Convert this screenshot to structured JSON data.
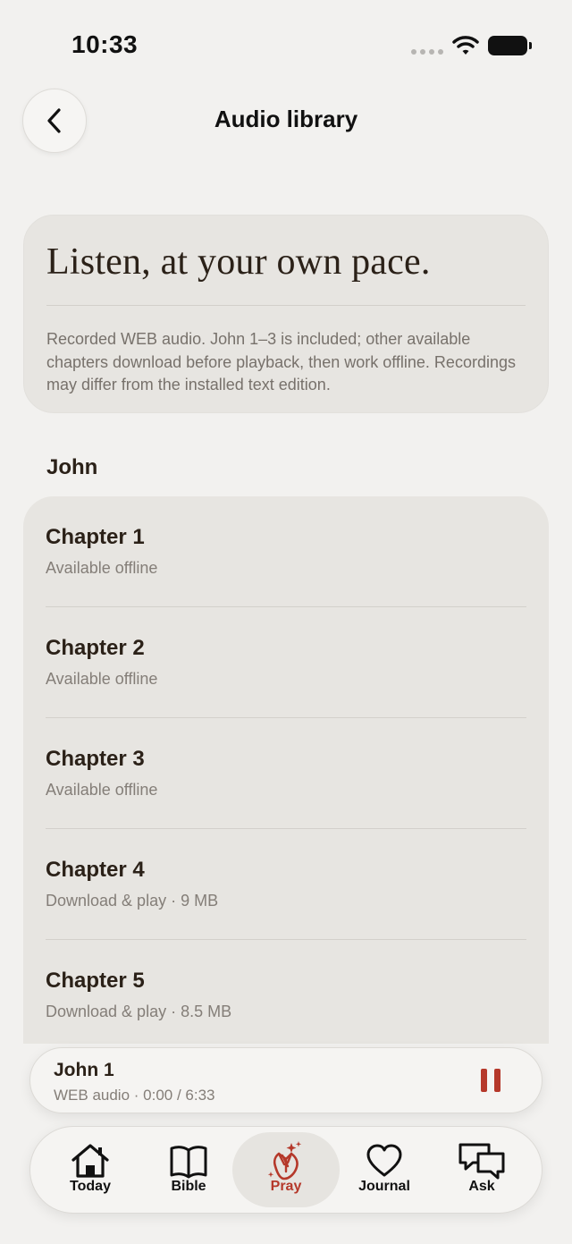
{
  "status_bar": {
    "time": "10:33"
  },
  "header": {
    "title": "Audio library"
  },
  "hero": {
    "heading": "Listen, at your own pace.",
    "body": "Recorded WEB audio. John 1–3 is included; other available chapters download before playback, then work offline. Recordings may differ from the installed text edition."
  },
  "section": {
    "label": "John"
  },
  "chapters": [
    {
      "title": "Chapter 1",
      "status": "Available offline"
    },
    {
      "title": "Chapter 2",
      "status": "Available offline"
    },
    {
      "title": "Chapter 3",
      "status": "Available offline"
    },
    {
      "title": "Chapter 4",
      "status": "Download & play · 9 MB"
    },
    {
      "title": "Chapter 5",
      "status": "Download & play · 8.5 MB"
    }
  ],
  "player": {
    "title": "John 1",
    "subtitle": "WEB audio · 0:00 / 6:33",
    "state": "playing"
  },
  "tabs": [
    {
      "label": "Today",
      "icon": "home-icon"
    },
    {
      "label": "Bible",
      "icon": "book-icon"
    },
    {
      "label": "Pray",
      "icon": "praying-hands-icon",
      "active": true
    },
    {
      "label": "Journal",
      "icon": "heart-icon"
    },
    {
      "label": "Ask",
      "icon": "chat-bubbles-icon"
    }
  ],
  "colors": {
    "background": "#f2f1ef",
    "card": "#e7e5e1",
    "accent": "#b5382a",
    "text": "#2b2118",
    "muted": "#847e78"
  }
}
